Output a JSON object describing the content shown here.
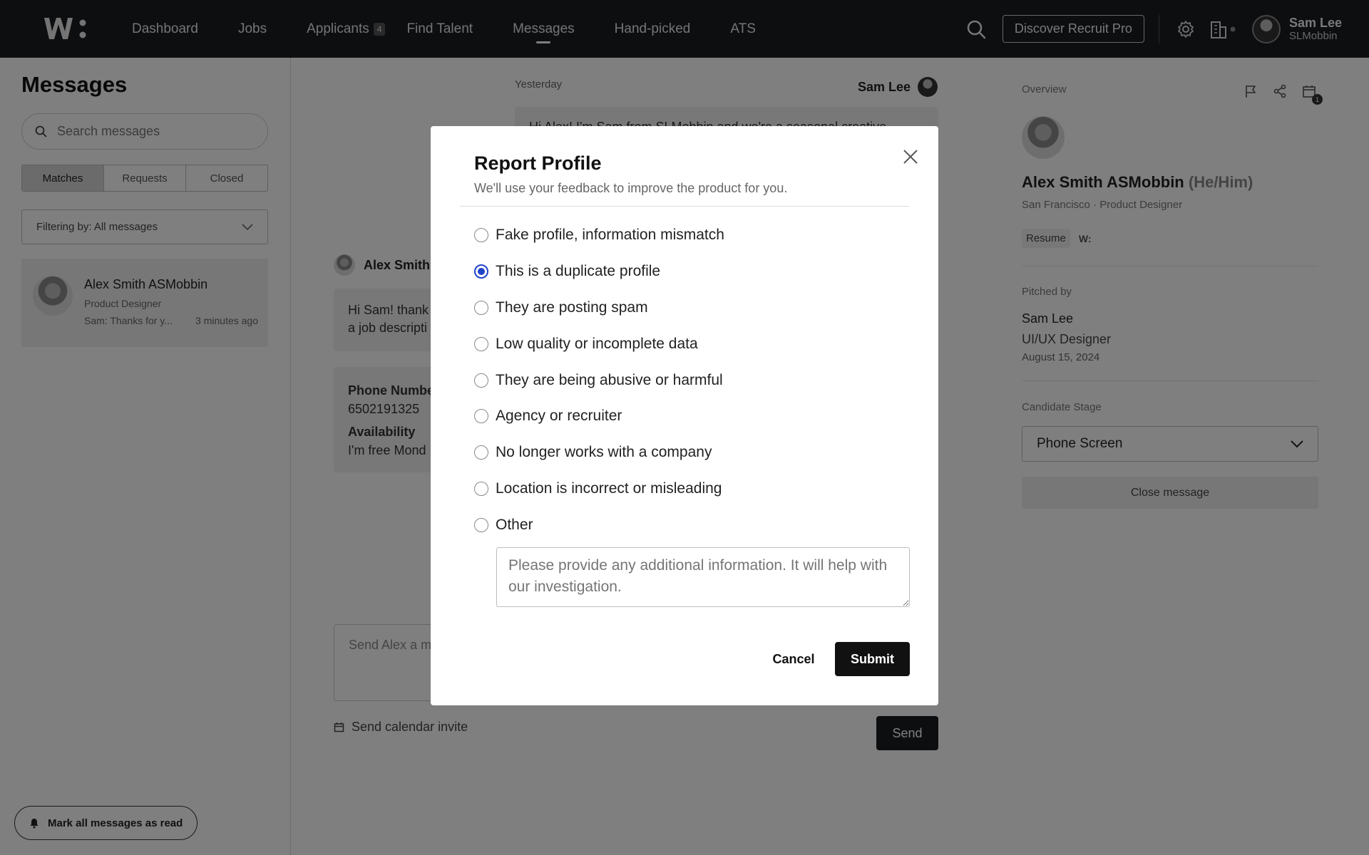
{
  "nav": {
    "logo_icon": "brand-logo-icon",
    "links": [
      {
        "label": "Dashboard"
      },
      {
        "label": "Jobs"
      },
      {
        "label": "Applicants",
        "badge": "4"
      },
      {
        "label": "Find Talent"
      },
      {
        "label": "Messages",
        "active": true
      },
      {
        "label": "Hand-picked"
      },
      {
        "label": "ATS"
      }
    ],
    "discover_label": "Discover Recruit Pro",
    "user_name": "Sam Lee",
    "user_org": "SLMobbin"
  },
  "messages": {
    "title": "Messages",
    "search_placeholder": "Search messages",
    "tabs": [
      "Matches",
      "Requests",
      "Closed"
    ],
    "active_tab": "Matches",
    "filter_label": "Filtering by: All messages",
    "conversations": [
      {
        "name": "Alex Smith ASMobbin",
        "role": "Product Designer",
        "preview": "Sam: Thanks for y...",
        "time": "3 minutes ago"
      }
    ],
    "mark_all_read": "Mark all messages as read"
  },
  "chat": {
    "day": "Yesterday",
    "outgoing_sender": "Sam Lee",
    "outgoing_text": "Hi Alex! I'm Sam from SLMobbin and we're a seasonal creative",
    "incoming_sender": "Alex Smith",
    "incoming_text_1": "Hi Sam! thank",
    "incoming_text_2": "a job descripti",
    "phone_label": "Phone Numbe",
    "phone_value": "6502191325",
    "availability_label": "Availability",
    "availability_value": "I'm free Mond",
    "compose_placeholder": "Send Alex a m",
    "calendar_invite": "Send calendar invite",
    "send_label": "Send"
  },
  "overview": {
    "label": "Overview",
    "calendar_badge": "1",
    "candidate_name": "Alex Smith ASMobbin",
    "pronouns": "(He/Him)",
    "meta": "San Francisco · Product Designer",
    "resume_label": "Resume",
    "w_label": "W:",
    "pitched_by_label": "Pitched by",
    "pitched_name": "Sam Lee",
    "pitched_role": "UI/UX Designer",
    "pitched_date": "August 15, 2024",
    "stage_label": "Candidate Stage",
    "stage_value": "Phone Screen",
    "close_label": "Close message"
  },
  "modal": {
    "title": "Report Profile",
    "subtitle": "We'll use your feedback to improve the product for you.",
    "options": [
      {
        "label": "Fake profile, information mismatch",
        "checked": false
      },
      {
        "label": "This is a duplicate profile",
        "checked": true
      },
      {
        "label": "They are posting spam",
        "checked": false
      },
      {
        "label": "Low quality or incomplete data",
        "checked": false
      },
      {
        "label": "They are being abusive or harmful",
        "checked": false
      },
      {
        "label": "Agency or recruiter",
        "checked": false
      },
      {
        "label": "No longer works with a company",
        "checked": false
      },
      {
        "label": "Location is incorrect or misleading",
        "checked": false
      },
      {
        "label": "Other",
        "checked": false
      }
    ],
    "extra_placeholder": "Please provide any additional information. It will help with our investigation.",
    "cancel_label": "Cancel",
    "submit_label": "Submit"
  },
  "colors": {
    "nav_bg": "#1a1d21",
    "accent_radio": "#1f44c8",
    "primary_button": "#111111"
  }
}
